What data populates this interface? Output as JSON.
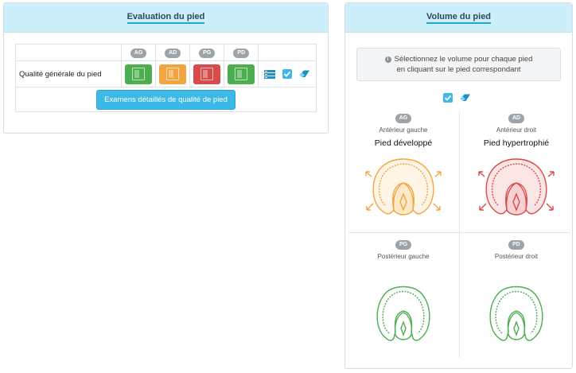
{
  "left_panel": {
    "title": "Evaluation du pied",
    "row_label": "Qualité générale du pied",
    "columns": [
      {
        "badge": "AG",
        "status": "green"
      },
      {
        "badge": "AD",
        "status": "orange"
      },
      {
        "badge": "PG",
        "status": "red"
      },
      {
        "badge": "PD",
        "status": "green"
      }
    ],
    "exam_button": "Examens détaillés de qualité de pied"
  },
  "right_panel": {
    "title": "Volume du pied",
    "info_icon": "i",
    "info_line1": "Sélectionnez le volume pour chaque pied",
    "info_line2": "en cliquant sur le pied correspondant",
    "quadrants": [
      {
        "badge": "AG",
        "label": "Antérieur gauche",
        "state": "Pied développé",
        "color": "#f0a540"
      },
      {
        "badge": "AD",
        "label": "Antérieur droit",
        "state": "Pied hypertrophié",
        "color": "#d94a4a"
      },
      {
        "badge": "PG",
        "label": "Postérieur gauche",
        "state": "",
        "color": "#4cae4f"
      },
      {
        "badge": "PD",
        "label": "Postérieur droit",
        "state": "",
        "color": "#4cae4f"
      }
    ]
  },
  "colors": {
    "green": "#4cae4f",
    "orange": "#f0a540",
    "red": "#d94a4a",
    "accent": "#1fa8d6"
  }
}
